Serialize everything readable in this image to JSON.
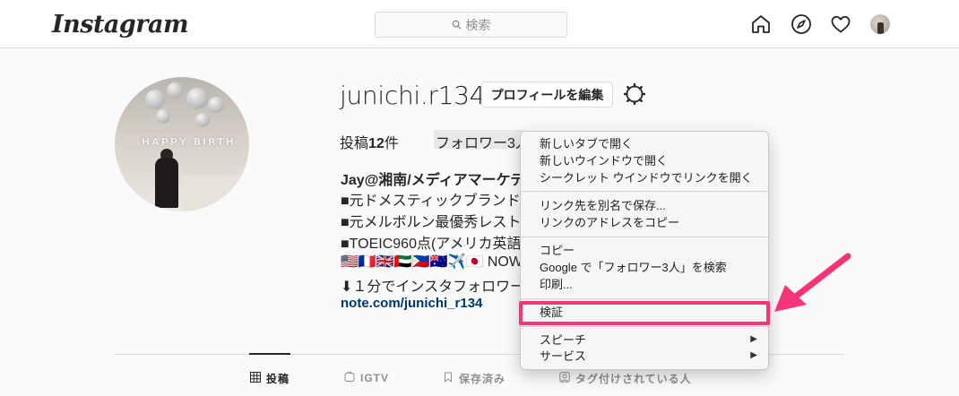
{
  "header": {
    "logo": "Instagram",
    "search_placeholder": "検索",
    "icons": [
      "home-icon",
      "explore-icon",
      "activity-heart-icon",
      "profile-avatar"
    ]
  },
  "profile": {
    "username": "junichi.r134",
    "edit_button": "プロフィールを編集",
    "posts_label": "投稿",
    "posts_count": "12",
    "posts_suffix": "件",
    "followers_text": "フォロワー3人",
    "bio_name": "Jay@湘南/メディアマーケテ",
    "bio_lines": [
      "■元ドメスティックブランド",
      "■元メルボルン最優秀レスト",
      "■TOEIC960点(アメリカ英語",
      "🇺🇸🇫🇷🇬🇧🇦🇪🇵🇭🇦🇺✈️🇯🇵 NOW",
      "⬇︎１分でインスタフォロワー"
    ],
    "link": "note.com/junichi_r134"
  },
  "tabs": [
    {
      "label": "投稿",
      "active": true
    },
    {
      "label": "IGTV",
      "active": false
    },
    {
      "label": "保存済み",
      "active": false
    },
    {
      "label": "タグ付けされている人",
      "active": false
    }
  ],
  "context_menu": {
    "items": [
      "新しいタブで開く",
      "新しいウインドウで開く",
      "シークレット ウインドウでリンクを開く",
      "リンク先を別名で保存...",
      "リンクのアドレスをコピー",
      "コピー",
      "Google で「フォロワー3人」を検索",
      "印刷...",
      "検証",
      "スピーチ",
      "サービス"
    ],
    "submenu_arrow": "▶",
    "highlighted_item": "検証"
  },
  "colors": {
    "highlight": "#f5357a",
    "link": "#00376b"
  }
}
